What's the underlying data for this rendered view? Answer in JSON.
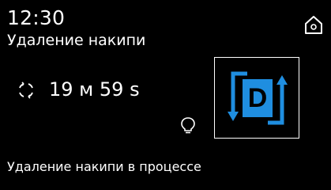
{
  "header": {
    "time": "12:30",
    "title": "Удаление накипи",
    "home_icon": "home-icon"
  },
  "program": {
    "timer": "19 м 59 s",
    "cycle_icon": "cycle-icon",
    "light_icon": "light-bulb-icon",
    "program_icon": "descale-program-icon",
    "program_letter": "D"
  },
  "status": {
    "text": "Удаление накипи в процессе"
  },
  "colors": {
    "background": "#000000",
    "text": "#ffffff",
    "accent": "#1f8ee0"
  }
}
